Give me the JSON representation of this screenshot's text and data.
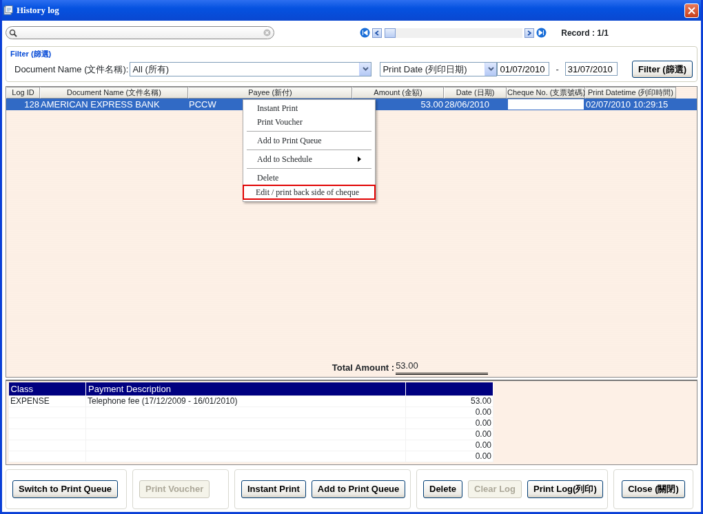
{
  "window": {
    "title": "History log"
  },
  "navigator": {
    "record": "Record : 1/1"
  },
  "filter": {
    "legend": "Filter (篩選)",
    "document_label": "Document Name (文件名稱):",
    "document_value": "All (所有)",
    "date_field": "Print Date (列印日期)",
    "date_from": "01/07/2010",
    "separator": "-",
    "date_to": "31/07/2010",
    "button": "Filter (篩選)"
  },
  "log_table": {
    "columns": [
      {
        "label": "Log ID",
        "kind": "text"
      },
      {
        "label": "Document Name (文件名稱)",
        "kind": "text"
      },
      {
        "label": "Payee (新付)",
        "kind": "text"
      },
      {
        "label": "Amount (金額)",
        "kind": "text"
      },
      {
        "label": "Date (日期)",
        "kind": "text"
      },
      {
        "label": "Cheque No. (支票號碼)",
        "kind": "input"
      },
      {
        "label": "Print Datetime (列印時間)",
        "kind": "text"
      }
    ],
    "rows": [
      {
        "selected": true,
        "cells": [
          "128",
          "AMERICAN EXPRESS BANK",
          "PCCW",
          "53.00",
          "28/06/2010",
          "",
          "02/07/2010 10:29:15"
        ]
      }
    ]
  },
  "context_menu": [
    {
      "kind": "item",
      "label": "Instant Print",
      "submenu": false,
      "outlined": false
    },
    {
      "kind": "item",
      "label": "Print Voucher",
      "submenu": false,
      "outlined": false
    },
    {
      "kind": "separator"
    },
    {
      "kind": "item",
      "label": "Add to Print Queue",
      "submenu": false,
      "outlined": false
    },
    {
      "kind": "separator"
    },
    {
      "kind": "item",
      "label": "Add to Schedule",
      "submenu": true,
      "outlined": false
    },
    {
      "kind": "separator"
    },
    {
      "kind": "item",
      "label": "Delete",
      "submenu": false,
      "outlined": false
    },
    {
      "kind": "item",
      "label": "Edit / print  back side of cheque",
      "submenu": false,
      "outlined": true
    }
  ],
  "total": {
    "label": "Total Amount :",
    "value": "53.00"
  },
  "detail_table": {
    "columns": [
      "Class",
      "Payment Description"
    ],
    "rows": [
      {
        "class": "EXPENSE",
        "description": "Telephone fee (17/12/2009 - 16/01/2010)",
        "amount": "53.00"
      },
      {
        "amount": "0.00"
      },
      {
        "amount": "0.00"
      },
      {
        "amount": "0.00"
      },
      {
        "amount": "0.00"
      },
      {
        "amount": "0.00"
      }
    ]
  },
  "button_groups": [
    [
      {
        "label": "Switch to Print Queue",
        "disabled": false
      }
    ],
    [
      {
        "label": "Print Voucher",
        "disabled": true
      }
    ],
    [
      {
        "label": "Instant Print",
        "disabled": false
      },
      {
        "label": "Add to Print Queue",
        "disabled": false
      }
    ],
    [
      {
        "label": "Delete",
        "disabled": false
      },
      {
        "label": "Clear Log",
        "disabled": true
      },
      {
        "label": "Print Log(列印)",
        "disabled": false
      }
    ],
    [
      {
        "label": "Close (關閉)",
        "disabled": false
      }
    ]
  ]
}
